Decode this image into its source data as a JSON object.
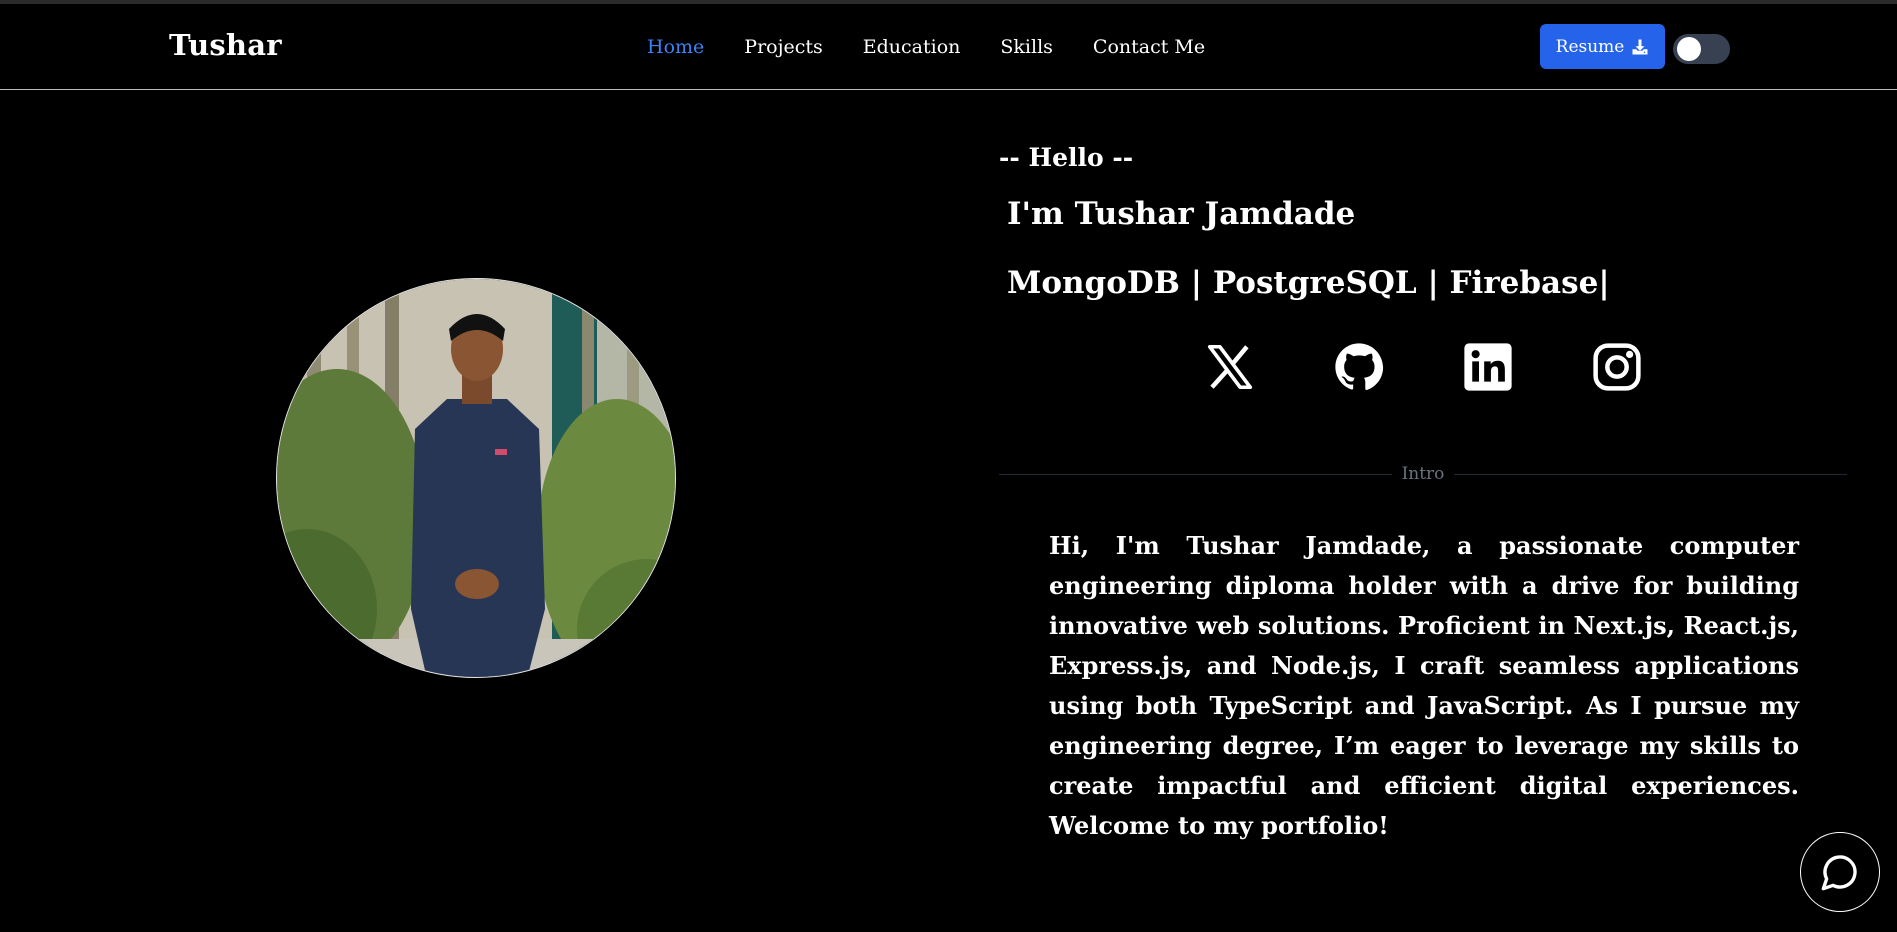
{
  "header": {
    "brand": "Tushar",
    "nav": [
      {
        "label": "Home",
        "active": true
      },
      {
        "label": "Projects",
        "active": false
      },
      {
        "label": "Education",
        "active": false
      },
      {
        "label": "Skills",
        "active": false
      },
      {
        "label": "Contact Me",
        "active": false
      }
    ],
    "resume_label": "Resume",
    "resume_icon": "download-icon",
    "theme_toggle": "off",
    "accent_color": "#2563eb"
  },
  "hero": {
    "photo": "profile-photo",
    "greeting": "-- Hello --",
    "name": "I'm Tushar Jamdade",
    "typing_text": "MongoDB | PostgreSQL | Firebase|",
    "socials": [
      "x-icon",
      "github-icon",
      "linkedin-icon",
      "instagram-icon"
    ],
    "divider_label": "Intro",
    "intro": "Hi, I'm Tushar Jamdade, a passionate computer engineering diploma holder with a drive for building innovative web solutions. Proficient in Next.js, React.js, Express.js, and Node.js, I craft seamless applications using both TypeScript and JavaScript. As I pursue my engineering degree, I’m eager to leverage my skills to create impactful and efficient digital experiences. Welcome to my portfolio!"
  },
  "chat": {
    "icon": "chat-bubble-icon"
  }
}
